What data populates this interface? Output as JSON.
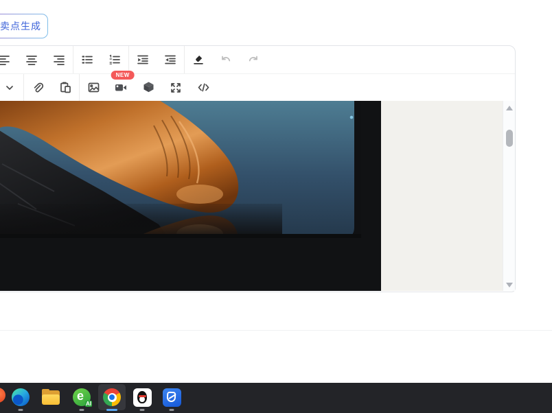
{
  "generate_panel": {
    "button_label": "卖点生成"
  },
  "editor_toolbar": {
    "row1_icons": [
      "align-left",
      "align-center",
      "align-right",
      "unordered-list",
      "ordered-list",
      "indent-increase",
      "indent-decrease",
      "clear-format",
      "undo",
      "redo"
    ],
    "row2_icons": [
      "collapse-chevron",
      "attachment",
      "paste",
      "insert-image",
      "insert-video",
      "insert-3d-model",
      "fullscreen",
      "source-code"
    ],
    "new_badge_label": "NEW",
    "disabled_icons": [
      "undo",
      "redo"
    ]
  },
  "content": {
    "photo": "copper-metallic-product-photo-on-teal-background",
    "scrollbar": {
      "has_up_arrow": true,
      "has_down_arrow": true,
      "thumb_position": "upper"
    }
  },
  "taskbar": {
    "apps": [
      {
        "name": "clipped-red-app",
        "indicator": false,
        "active": false
      },
      {
        "name": "microsoft-edge",
        "indicator": true,
        "active": false
      },
      {
        "name": "file-explorer",
        "indicator": false,
        "active": false
      },
      {
        "name": "browser-360-ai",
        "glyph": "e",
        "badge": "AI",
        "indicator": true,
        "active": false
      },
      {
        "name": "google-chrome",
        "indicator": true,
        "active": true
      },
      {
        "name": "qq",
        "indicator": true,
        "active": false
      },
      {
        "name": "pc-manager",
        "indicator": true,
        "active": false
      }
    ]
  },
  "colors": {
    "accent_blue": "#3d63d9",
    "badge_red": "#f45959",
    "panel_border": "#e2e4e8",
    "teal_top": "#4e7d93",
    "teal_bottom": "#24384b",
    "copper_mid": "#c0712b",
    "beige_panel": "#f2f1ed",
    "taskbar_bg": "#232428",
    "active_indicator": "#5aa7f0"
  }
}
